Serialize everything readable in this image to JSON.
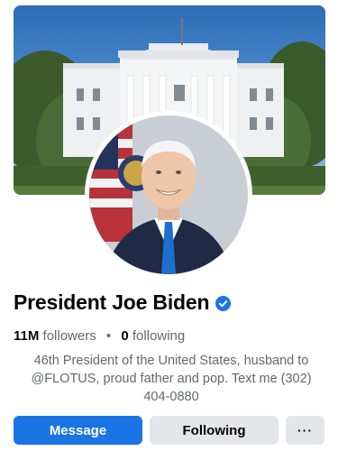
{
  "profile": {
    "name": "President Joe Biden",
    "verified": true,
    "followers_count": "11M",
    "followers_label": "followers",
    "separator": "•",
    "following_count": "0",
    "following_label": "following",
    "bio": "46th President of the United States, husband to @FLOTUS, proud father and pop. Text me (302) 404-0880"
  },
  "actions": {
    "message_label": "Message",
    "following_label": "Following",
    "more_label": "···"
  },
  "colors": {
    "primary_button": "#1b74e4",
    "secondary_button": "#e4e6eb",
    "verified_badge": "#1b74e4",
    "secondary_text": "#65676b"
  },
  "icons": {
    "verified": "verified-badge-icon",
    "more": "more-options-icon"
  }
}
